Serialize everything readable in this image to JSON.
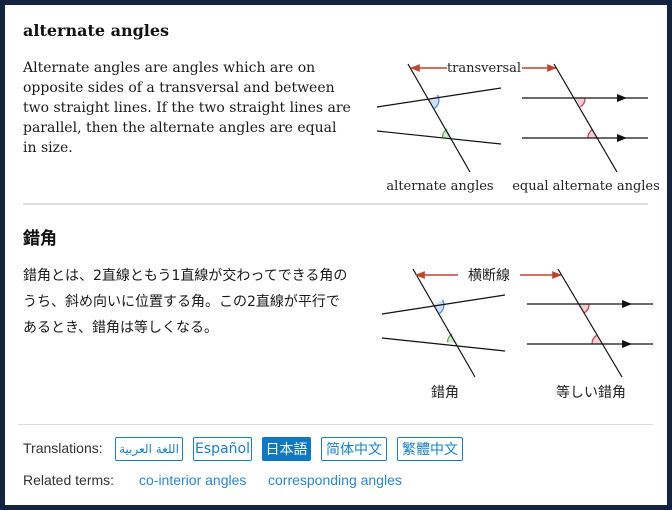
{
  "english": {
    "title": "alternate angles",
    "definition": "Alternate angles are angles which are on opposite sides of a transversal and between two straight lines. If the two straight lines are parallel, then the alternate angles are equal in size.",
    "diagram": {
      "transversal_label": "transversal",
      "left_caption": "alternate angles",
      "right_caption": "equal alternate angles"
    }
  },
  "japanese": {
    "title": "錯角",
    "definition": "錯角とは、2直線ともう1直線が交わってできる角のうち、斜め向いに位置する角。この2直線が平行であるとき、錯角は等しくなる。",
    "diagram": {
      "transversal_label": "横断線",
      "left_caption": "錯角",
      "right_caption": "等しい錯角"
    }
  },
  "footer": {
    "translations_label": "Translations:",
    "translations": [
      {
        "label": "اللغة العربية",
        "active": false
      },
      {
        "label": "Español",
        "active": false
      },
      {
        "label": "日本語",
        "active": true
      },
      {
        "label": "简体中文",
        "active": false
      },
      {
        "label": "繁體中文",
        "active": false
      }
    ],
    "related_label": "Related terms:",
    "related_terms": [
      "co-interior angles",
      "corresponding angles"
    ]
  },
  "colors": {
    "frame": "#14233f",
    "accent": "#0f78c2",
    "link": "#2b86cf",
    "arrow": "#c0452a",
    "angle_blue": "#4a8fdc",
    "angle_green": "#5aa84e",
    "angle_pink": "#d0454a"
  }
}
